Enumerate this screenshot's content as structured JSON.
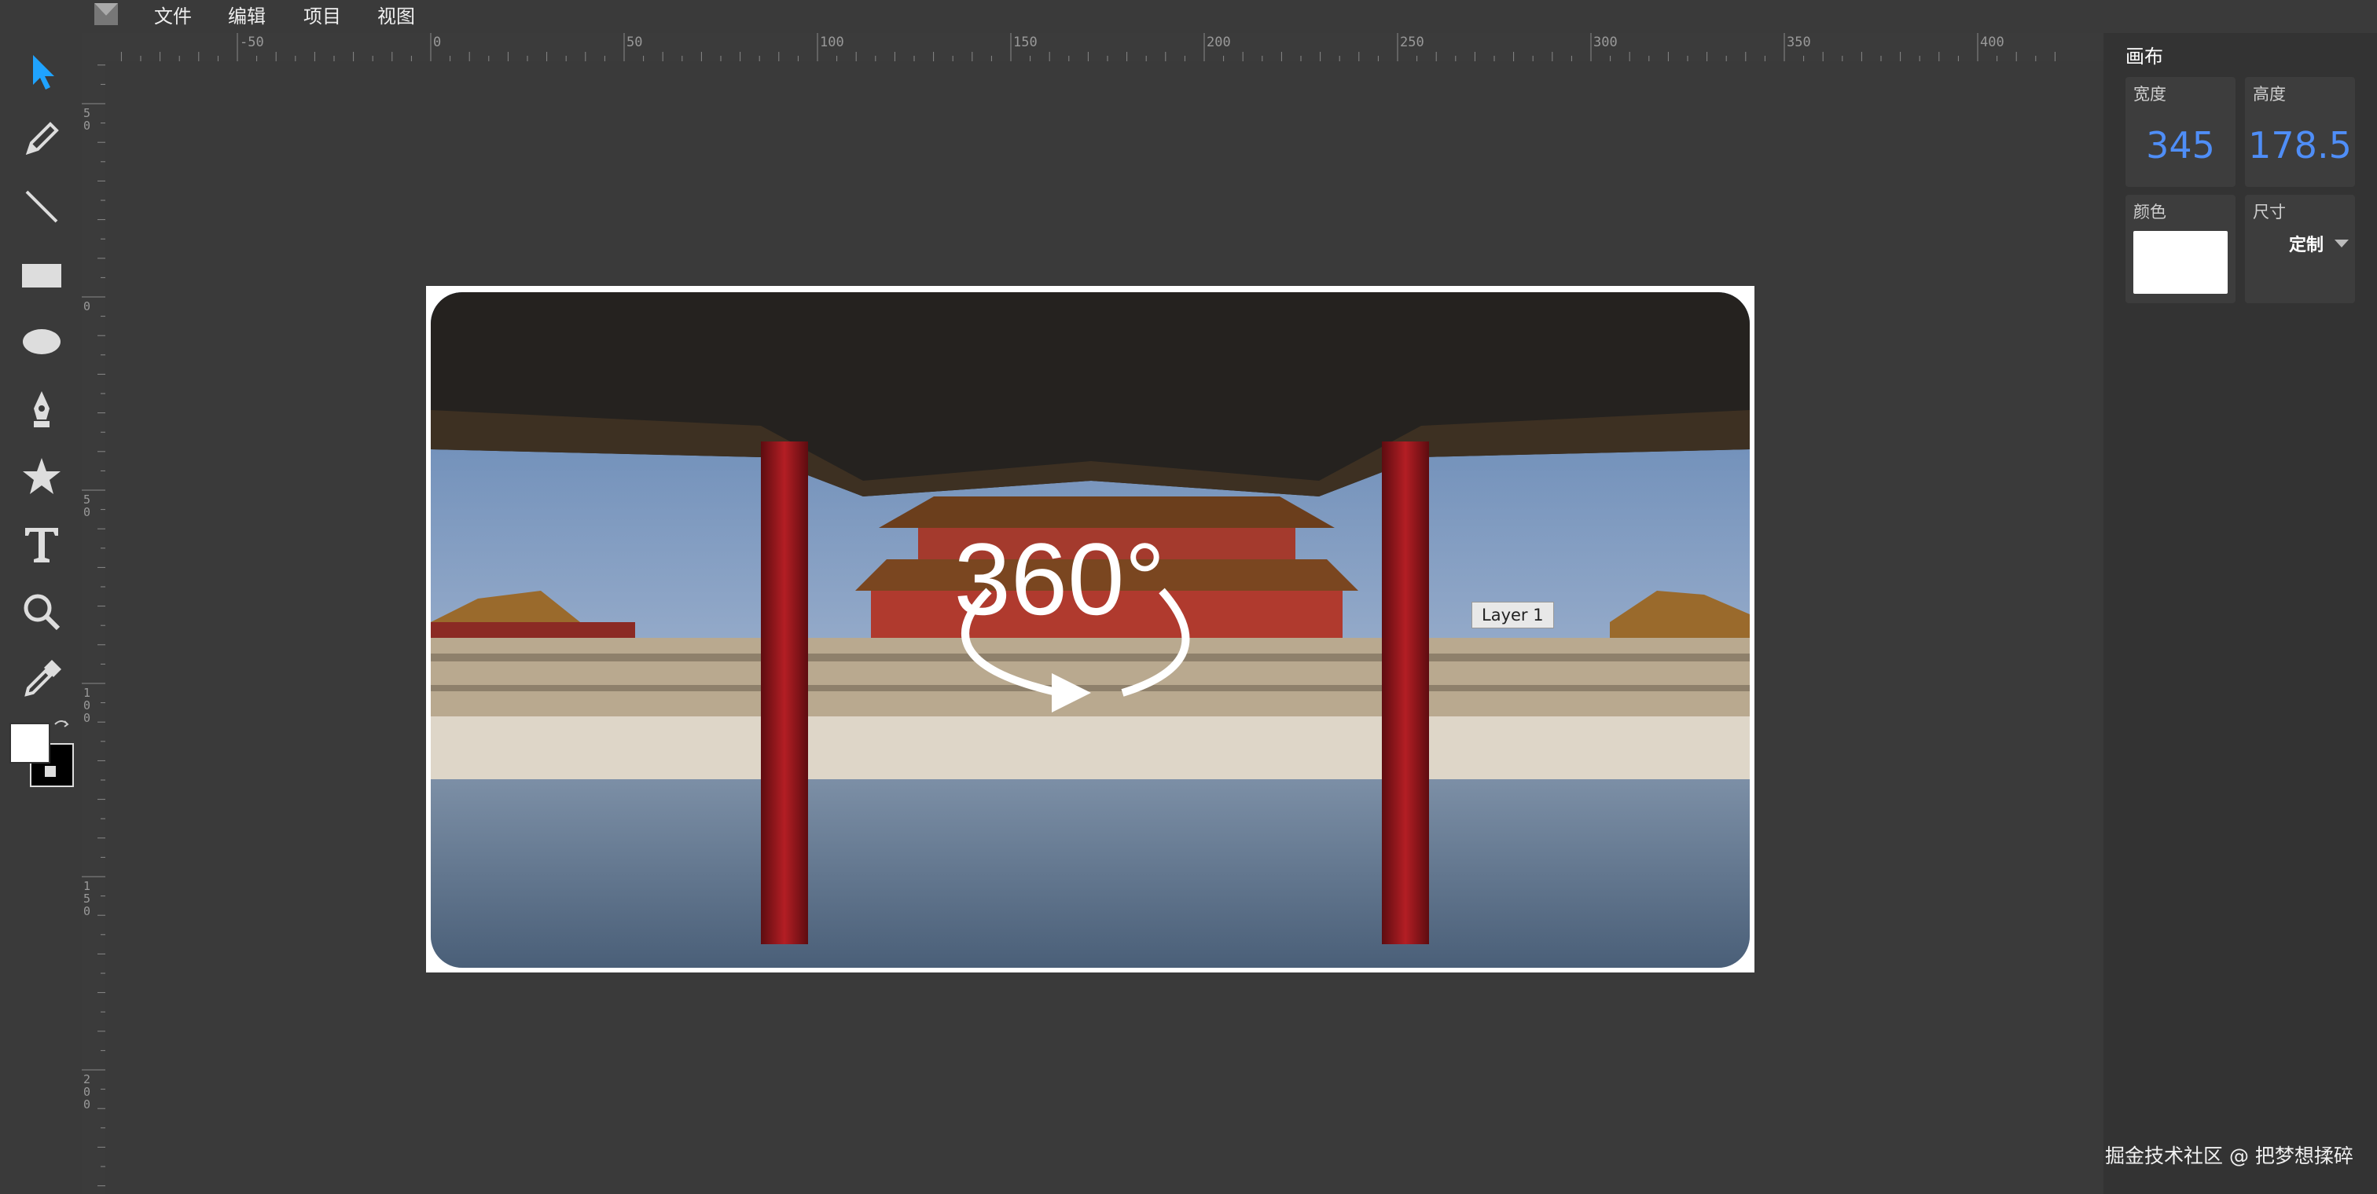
{
  "menu": {
    "file": "文件",
    "edit": "编辑",
    "project": "项目",
    "view": "视图"
  },
  "tools": [
    "select-icon",
    "pencil-icon",
    "line-icon",
    "rectangle-icon",
    "ellipse-icon",
    "pen-icon",
    "star-icon",
    "text-icon",
    "zoom-icon",
    "eyedropper-icon"
  ],
  "colors": {
    "foreground": "#ffffff",
    "background": "#000000",
    "accent": "#4f8ef7",
    "select_tool": "#1fa3ff"
  },
  "ruler": {
    "top_labels": [
      "-50",
      "0",
      "50",
      "100",
      "150",
      "200",
      "250",
      "300",
      "350",
      "400"
    ],
    "left_labels": [
      "50",
      "0",
      "50",
      "100",
      "150",
      "200"
    ]
  },
  "canvas": {
    "layer_label": "Layer 1",
    "overlay_text": "360°"
  },
  "panel": {
    "title": "画布",
    "width_label": "宽度",
    "width_value": "345",
    "height_label": "高度",
    "height_value": "178.5",
    "color_label": "颜色",
    "size_label": "尺寸",
    "size_value": "定制"
  },
  "watermark": "掘金技术社区 @ 把梦想揉碎"
}
